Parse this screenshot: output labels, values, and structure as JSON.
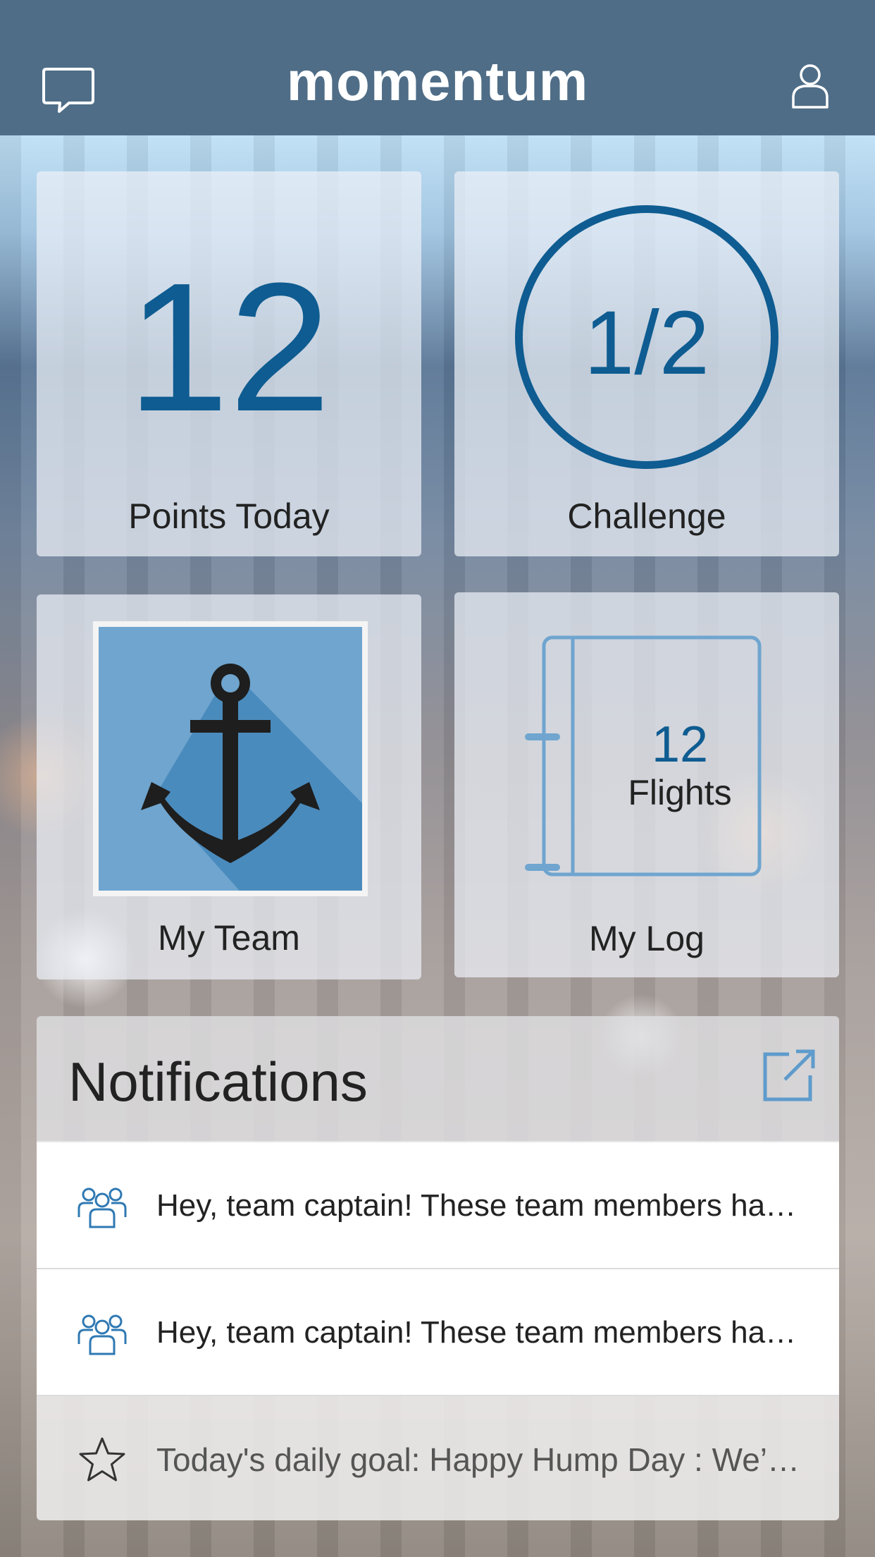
{
  "app": {
    "title": "momentum"
  },
  "header": {
    "left_icon": "chat-bubble-icon",
    "right_icon": "user-profile-icon"
  },
  "tiles": {
    "points": {
      "value": "12",
      "label": "Points Today"
    },
    "challenge": {
      "value": "1/2",
      "label": "Challenge",
      "progress": 1.0
    },
    "team": {
      "label": "My Team",
      "badge_icon": "anchor-icon"
    },
    "log": {
      "count": "12",
      "unit": "Flights",
      "label": "My Log",
      "icon": "notebook-icon"
    }
  },
  "notifications": {
    "title": "Notifications",
    "action_icon": "external-link-icon",
    "items": [
      {
        "icon": "team-group-icon",
        "text": "Hey, team captain! These team members have not logged activity recently"
      },
      {
        "icon": "team-group-icon",
        "text": "Hey, team captain! These team members have not logged activity recently"
      },
      {
        "icon": "star-icon",
        "text": "Today's daily goal: Happy Hump Day : We’re halfway through the week"
      }
    ]
  },
  "colors": {
    "header_bg": "#4f6d87",
    "accent": "#0e5c91",
    "light_accent": "#6fa5cf",
    "text": "#222222"
  }
}
